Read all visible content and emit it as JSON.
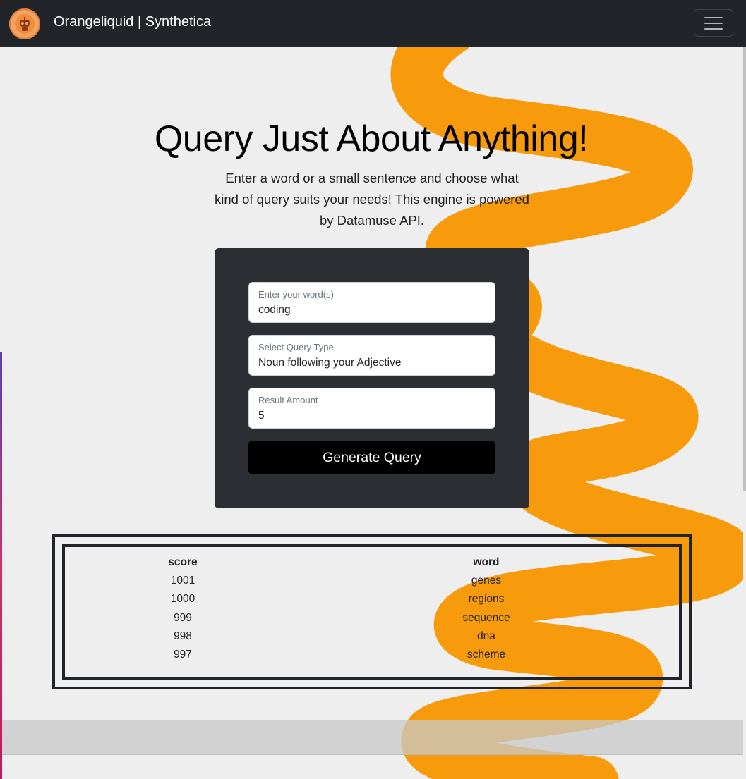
{
  "navbar": {
    "brand_name": "Orangeliquid | Synthetica",
    "logo_icon": "robot-avatar-icon",
    "toggle_icon": "hamburger-menu-icon"
  },
  "hero": {
    "title": "Query Just About Anything!",
    "description": "Enter a word or a small sentence and choose what kind of query suits your needs! This engine is powered by Datamuse API."
  },
  "form": {
    "word_label": "Enter your word(s)",
    "word_value": "coding",
    "query_type_label": "Select Query Type",
    "query_type_value": "Noun following your Adjective",
    "amount_label": "Result Amount",
    "amount_value": "5",
    "submit_label": "Generate Query"
  },
  "results": {
    "headers": [
      "score",
      "word"
    ],
    "rows": [
      [
        "1001",
        "genes"
      ],
      [
        "1000",
        "regions"
      ],
      [
        "999",
        "sequence"
      ],
      [
        "998",
        "dna"
      ],
      [
        "997",
        "scheme"
      ]
    ]
  },
  "colors": {
    "navbar_bg": "#212529",
    "page_bg": "#eeeeee",
    "accent_orange": "#f79a0c",
    "card_bg": "#2b2f33",
    "button_bg": "#000000"
  }
}
